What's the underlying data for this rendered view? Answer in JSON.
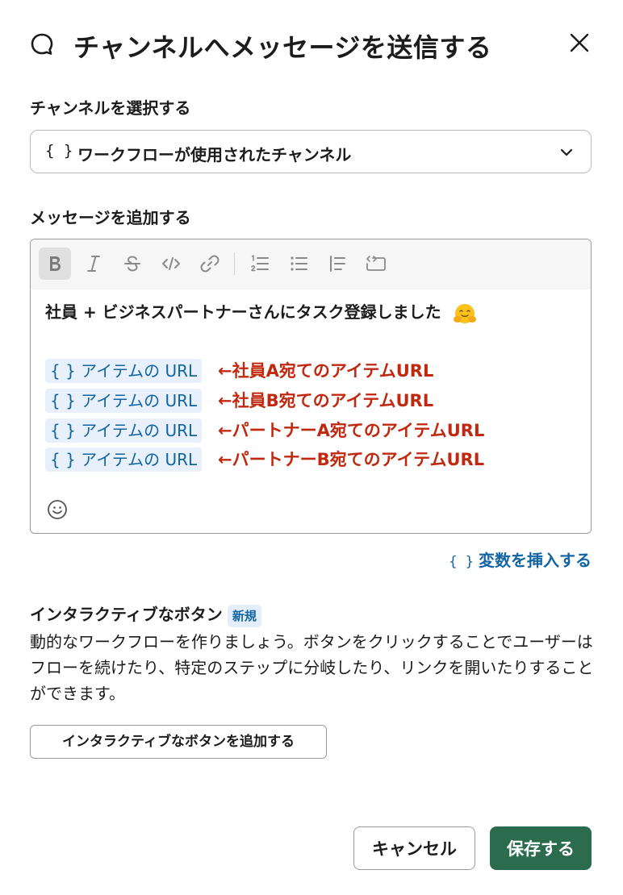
{
  "dialog": {
    "title": "チャンネルへメッセージを送信する",
    "icons": {
      "title": "chat-bubble-icon",
      "close": "close-icon"
    }
  },
  "channel": {
    "label": "チャンネルを選択する",
    "selected": "ワークフローが使用されたチャンネル",
    "variable_icon": "{ }",
    "chevron_icon": "chevron-down-icon"
  },
  "message": {
    "label": "メッセージを追加する",
    "toolbar": [
      "bold",
      "italic",
      "strikethrough",
      "code",
      "link",
      "ordered-list",
      "bulleted-list",
      "blockquote",
      "code-block"
    ],
    "text": "社員 + ビジネスパートナーさんにタスク登録しました",
    "emoji_name": "hugging-face-emoji",
    "variables": [
      {
        "chip": "{ } アイテムの URL",
        "annotation": "←社員A宛てのアイテムURL"
      },
      {
        "chip": "{ } アイテムの URL",
        "annotation": "←社員B宛てのアイテムURL"
      },
      {
        "chip": "{ } アイテムの URL",
        "annotation": "←パートナーA宛てのアイテムURL"
      },
      {
        "chip": "{ } アイテムの URL",
        "annotation": "←パートナーB宛てのアイテムURL"
      }
    ],
    "insert_variable_braces": "{ }",
    "insert_variable_label": "変数を挿入する"
  },
  "interactive": {
    "title": "インタラクティブなボタン",
    "badge": "新規",
    "description": "動的なワークフローを作りましょう。ボタンをクリックすることでユーザーはフローを続けたり、特定のステップに分岐したり、リンクを開いたりすることができます。",
    "add_button": "インタラクティブなボタンを追加する"
  },
  "footer": {
    "cancel": "キャンセル",
    "save": "保存する"
  },
  "colors": {
    "primary": "#2b6c4f",
    "link": "#1264a3",
    "annotation": "#c0290f",
    "chip_bg": "#e8f1fb"
  }
}
